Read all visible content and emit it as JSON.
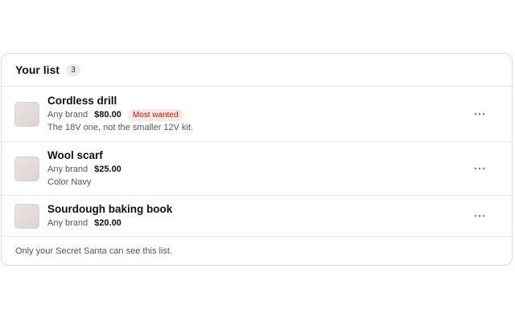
{
  "list": {
    "title": "Your list",
    "count": "3",
    "items": [
      {
        "name": "Cordless drill",
        "brand": "Any brand",
        "price": "$80.00",
        "tag": "Most wanted",
        "note": "The 18V one, not the smaller 12V kit."
      },
      {
        "name": "Wool scarf",
        "brand": "Any brand",
        "price": "$25.00",
        "note": "Color Navy"
      },
      {
        "name": "Sourdough baking book",
        "brand": "Any brand",
        "price": "$20.00"
      }
    ],
    "footer_note": "Only your Secret Santa can see this list."
  },
  "icons": {
    "more": "more-horizontal-icon"
  },
  "colors": {
    "tag_background": "#fde8e6",
    "tag_text": "#a61b12",
    "thumbnail": "#e5dcdc"
  }
}
